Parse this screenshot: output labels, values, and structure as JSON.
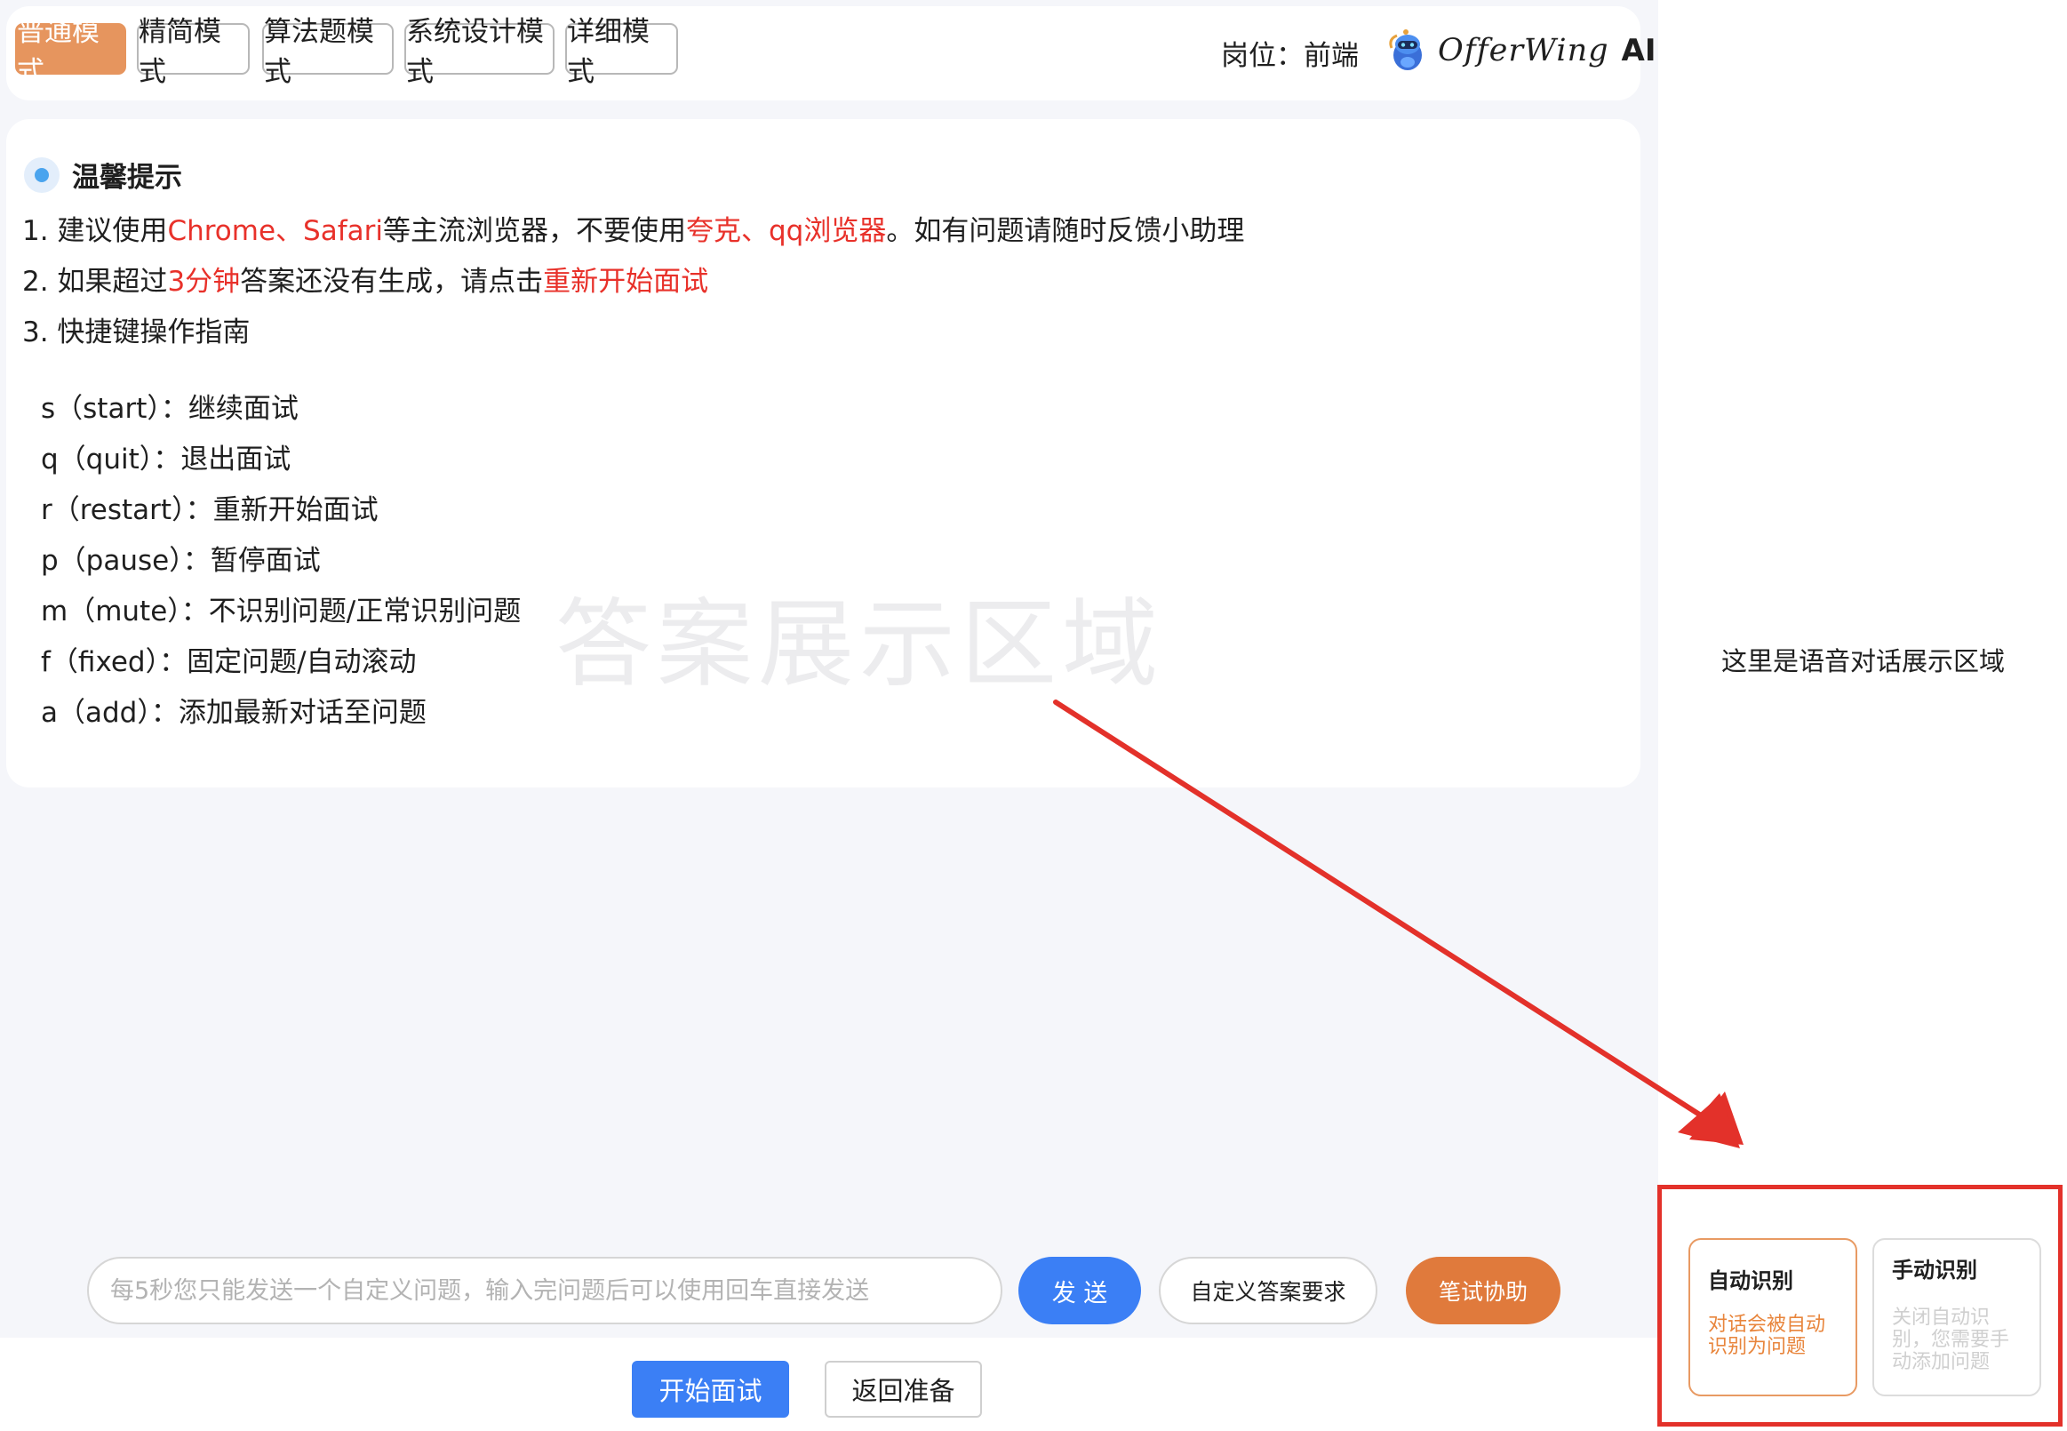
{
  "header": {
    "modes": [
      {
        "label": "普通模式",
        "active": true
      },
      {
        "label": "精简模式",
        "active": false
      },
      {
        "label": "算法题模式",
        "active": false
      },
      {
        "label": "系统设计模式",
        "active": false
      },
      {
        "label": "详细模式",
        "active": false
      }
    ],
    "role_text": "岗位：前端",
    "brand_name": "OfferWing",
    "brand_suffix": "AI"
  },
  "tips": {
    "title": "温馨提示",
    "line1": {
      "a": "1. 建议使用",
      "b": "Chrome、Safari",
      "c": "等主流浏览器，不要使用",
      "d": "夸克、qq浏览器",
      "e": "。如有问题请随时反馈小助理"
    },
    "line2": {
      "a": "2. 如果超过",
      "b": "3分钟",
      "c": "答案还没有生成，请点击",
      "d": "重新开始面试"
    },
    "line3": "3. 快捷键操作指南",
    "shortcuts": [
      "s（start）：继续面试",
      "q（quit）：退出面试",
      "r（restart）：重新开始面试",
      "p（pause）：暂停面试",
      "m（mute）：不识别问题/正常识别问题",
      "f（fixed）：固定问题/自动滚动",
      "a（add）：添加最新对话至问题"
    ]
  },
  "answer_area_watermark": "答案展示区域",
  "input_bar": {
    "placeholder": "每5秒您只能发送一个自定义问题，输入完问题后可以使用回车直接发送",
    "value": "",
    "send_label": "发 送",
    "custom_answer_label": "自定义答案要求",
    "written_test_label": "笔试协助"
  },
  "actions": {
    "start_label": "开始面试",
    "back_label": "返回准备"
  },
  "voice_panel": {
    "label": "这里是语音对话展示区域",
    "auto_card": {
      "title": "自动识别",
      "desc_lines": [
        "对话会被自动",
        "识别为问题"
      ]
    },
    "manual_card": {
      "title": "手动识别",
      "desc_lines": [
        "关闭自动识",
        "别，您需要手",
        "动添加问题"
      ]
    }
  },
  "colors": {
    "accent_orange": "#e6955e",
    "primary_blue": "#3b7ff5",
    "highlight_red": "#e3312a",
    "tip_red": "#e8312a"
  }
}
